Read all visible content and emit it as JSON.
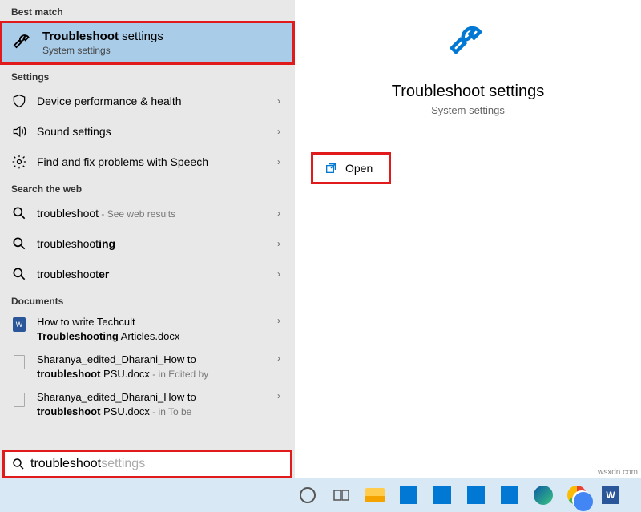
{
  "sections": {
    "best_match_header": "Best match",
    "settings_header": "Settings",
    "web_header": "Search the web",
    "documents_header": "Documents"
  },
  "best_match": {
    "title_bold": "Troubleshoot",
    "title_rest": " settings",
    "subtitle": "System settings"
  },
  "settings_items": [
    {
      "label": "Device performance & health"
    },
    {
      "label": "Sound settings"
    },
    {
      "label": "Find and fix problems with Speech"
    }
  ],
  "web_items": [
    {
      "prefix": "troubleshoot",
      "rest": " - ",
      "see": "See web results"
    },
    {
      "prefix": "troubleshoot",
      "bold": "ing"
    },
    {
      "prefix": "troubleshoot",
      "bold": "er"
    }
  ],
  "documents": [
    {
      "l1a": "How to write Techcult",
      "l2_bold": "Troubleshooting",
      "l2_rest": " Articles.docx",
      "path": ""
    },
    {
      "l1a": "Sharanya_edited_Dharani_How to",
      "l2_bold": "troubleshoot",
      "l2_rest": " PSU.docx",
      "path": " - in Edited by"
    },
    {
      "l1a": "Sharanya_edited_Dharani_How to",
      "l2_bold": "troubleshoot",
      "l2_rest": " PSU.docx",
      "path": " - in To be"
    }
  ],
  "search": {
    "typed": "troubleshoot",
    "suggestion": " settings"
  },
  "detail": {
    "title": "Troubleshoot settings",
    "subtitle": "System settings",
    "open_label": "Open"
  },
  "watermark": "wsxdn.com"
}
